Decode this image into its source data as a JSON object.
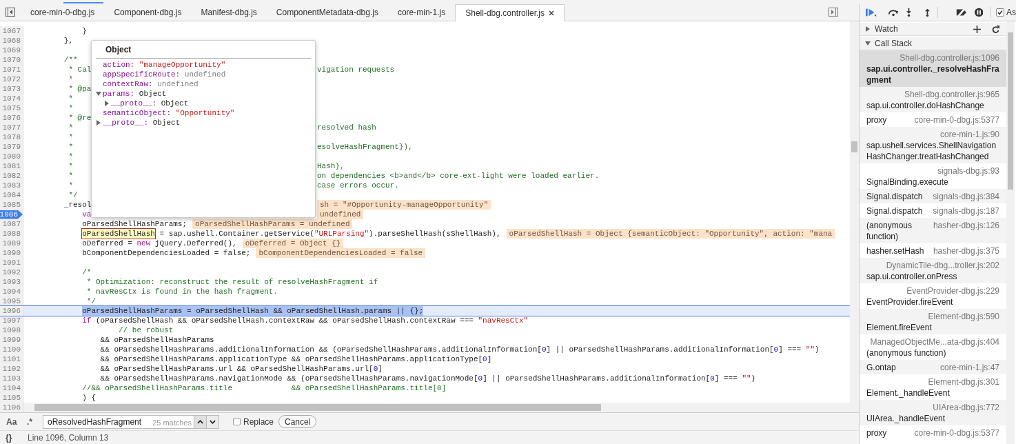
{
  "tabs": [
    {
      "label": "core-min-0-dbg.js",
      "selected": false
    },
    {
      "label": "Component-dbg.js",
      "selected": false
    },
    {
      "label": "Manifest-dbg.js",
      "selected": false
    },
    {
      "label": "ComponentMetadata-dbg.js",
      "selected": false
    },
    {
      "label": "core-min-1.js",
      "selected": false
    },
    {
      "label": "Shell-dbg.controller.js",
      "selected": true
    }
  ],
  "code": {
    "lines": [
      {
        "number": "1067",
        "breakpoint": false,
        "current": false,
        "segments": [
          {
            "kind": "plain",
            "text": "            }"
          }
        ]
      },
      {
        "number": "1068",
        "breakpoint": false,
        "current": false,
        "segments": [
          {
            "kind": "plain",
            "text": "        },"
          }
        ]
      },
      {
        "number": "1069",
        "breakpoint": false,
        "current": false
      },
      {
        "number": "1070",
        "breakpoint": false,
        "current": false,
        "segments": [
          {
            "kind": "comment",
            "text": "        /**"
          }
        ]
      },
      {
        "number": "1071",
        "breakpoint": false,
        "current": false,
        "segments": [
          {
            "kind": "comment",
            "text": "         * Cal"
          }
        ],
        "after_popover": [
          {
            "kind": "comment",
            "text": "vigation requests"
          }
        ]
      },
      {
        "number": "1072",
        "breakpoint": false,
        "current": false,
        "segments": [
          {
            "kind": "comment",
            "text": "         *"
          }
        ]
      },
      {
        "number": "1073",
        "breakpoint": false,
        "current": false,
        "segments": [
          {
            "kind": "comment",
            "text": "         * @pa"
          }
        ]
      },
      {
        "number": "1074",
        "breakpoint": false,
        "current": false,
        "segments": [
          {
            "kind": "comment",
            "text": "         *"
          }
        ]
      },
      {
        "number": "1075",
        "breakpoint": false,
        "current": false,
        "segments": [
          {
            "kind": "comment",
            "text": "         *"
          }
        ]
      },
      {
        "number": "1076",
        "breakpoint": false,
        "current": false,
        "segments": [
          {
            "kind": "comment",
            "text": "         * @re"
          }
        ]
      },
      {
        "number": "1077",
        "breakpoint": false,
        "current": false,
        "segments": [
          {
            "kind": "comment",
            "text": "         *"
          }
        ],
        "after_popover": [
          {
            "kind": "comment",
            "text": "resolved hash"
          }
        ]
      },
      {
        "number": "1078",
        "breakpoint": false,
        "current": false,
        "segments": [
          {
            "kind": "comment",
            "text": "         *"
          }
        ]
      },
      {
        "number": "1079",
        "breakpoint": false,
        "current": false,
        "segments": [
          {
            "kind": "comment",
            "text": "         *"
          }
        ],
        "after_popover": [
          {
            "kind": "comment",
            "text": "esolveHashFragment}),"
          }
        ]
      },
      {
        "number": "1080",
        "breakpoint": false,
        "current": false,
        "segments": [
          {
            "kind": "comment",
            "text": "         *"
          }
        ]
      },
      {
        "number": "1081",
        "breakpoint": false,
        "current": false,
        "segments": [
          {
            "kind": "comment",
            "text": "         *"
          }
        ],
        "after_popover": [
          {
            "kind": "comment",
            "text": "Hash},"
          }
        ]
      },
      {
        "number": "1082",
        "breakpoint": false,
        "current": false,
        "segments": [
          {
            "kind": "comment",
            "text": "         *"
          }
        ],
        "after_popover": [
          {
            "kind": "comment",
            "text": "on dependencies <b>and</b> core-ext-light were loaded earlier."
          }
        ]
      },
      {
        "number": "1083",
        "breakpoint": false,
        "current": false,
        "segments": [
          {
            "kind": "comment",
            "text": "         *"
          }
        ],
        "after_popover": [
          {
            "kind": "comment",
            "text": "case errors occur."
          }
        ]
      },
      {
        "number": "1084",
        "breakpoint": false,
        "current": false,
        "segments": [
          {
            "kind": "comment",
            "text": "         */"
          }
        ]
      },
      {
        "number": "1085",
        "breakpoint": false,
        "current": false,
        "segments": [
          {
            "kind": "plain",
            "text": "        _resol"
          }
        ],
        "after_popover": [
          {
            "kind": "inline_value",
            "text": "sh = \"#Opportunity-manageOpportunity\""
          }
        ]
      },
      {
        "number": "1086",
        "breakpoint": true,
        "current": false,
        "segments": [
          {
            "kind": "keyword",
            "text": "            va"
          }
        ],
        "after_popover": [
          {
            "kind": "inline_value",
            "text": "undefined"
          }
        ]
      },
      {
        "number": "1087",
        "breakpoint": false,
        "current": false,
        "segments": [
          {
            "kind": "plain",
            "text": "            oParsedShellHashParams;"
          },
          {
            "kind": "inline_value",
            "text": "oParsedShellHashParams = undefined"
          }
        ]
      },
      {
        "number": "1088",
        "breakpoint": false,
        "current": false,
        "segments": [
          {
            "kind": "hovered",
            "text": "            oParsedShellHash"
          },
          {
            "kind": "plain",
            "text": " = sap.ushell.Container.getService("
          },
          {
            "kind": "string",
            "text": "\"URLParsing\""
          },
          {
            "kind": "plain",
            "text": ").parseShellHash(sShellHash),"
          },
          {
            "kind": "inline_value",
            "text": "oParsedShellHash = Object {semanticObject: \"Opportunity\", action: \"mana"
          }
        ]
      },
      {
        "number": "1089",
        "breakpoint": false,
        "current": false,
        "segments": [
          {
            "kind": "plain",
            "text": "            oDeferred = "
          },
          {
            "kind": "keyword",
            "text": "new"
          },
          {
            "kind": "plain",
            "text": " jQuery.Deferred(),"
          },
          {
            "kind": "inline_value",
            "text": "oDeferred = Object {}"
          }
        ]
      },
      {
        "number": "1090",
        "breakpoint": false,
        "current": false,
        "segments": [
          {
            "kind": "plain",
            "text": "            bComponentDependenciesLoaded = false;"
          },
          {
            "kind": "inline_value",
            "text": "bComponentDependenciesLoaded = false"
          }
        ]
      },
      {
        "number": "1091",
        "breakpoint": false,
        "current": false
      },
      {
        "number": "1092",
        "breakpoint": false,
        "current": false,
        "segments": [
          {
            "kind": "comment",
            "text": "            /*"
          }
        ]
      },
      {
        "number": "1093",
        "breakpoint": false,
        "current": false,
        "segments": [
          {
            "kind": "comment",
            "text": "             * Optimization: reconstruct the result of resolveHashFragment if"
          }
        ]
      },
      {
        "number": "1094",
        "breakpoint": false,
        "current": false,
        "segments": [
          {
            "kind": "comment",
            "text": "             * navResCtx is found in the hash fragment."
          }
        ]
      },
      {
        "number": "1095",
        "breakpoint": false,
        "current": false,
        "segments": [
          {
            "kind": "comment",
            "text": "             */"
          }
        ]
      },
      {
        "number": "1096",
        "breakpoint": false,
        "current": true,
        "segments": [
          {
            "kind": "match",
            "text": "            oParsedShellHashParams = oParsedShellHash && oParsedShellHash.params || {};"
          }
        ]
      },
      {
        "number": "1097",
        "breakpoint": false,
        "current": false,
        "segments": [
          {
            "kind": "keyword",
            "text": "            if"
          },
          {
            "kind": "plain",
            "text": " (oParsedShellHash && oParsedShellHash.contextRaw && oParsedShellHash.contextRaw === "
          },
          {
            "kind": "string",
            "text": "\"navResCtx\""
          }
        ]
      },
      {
        "number": "1098",
        "breakpoint": false,
        "current": false,
        "segments": [
          {
            "kind": "comment",
            "text": "                    // be robust"
          }
        ]
      },
      {
        "number": "1099",
        "breakpoint": false,
        "current": false,
        "segments": [
          {
            "kind": "plain",
            "text": "                && oParsedShellHashParams"
          }
        ]
      },
      {
        "number": "1100",
        "breakpoint": false,
        "current": false,
        "segments": [
          {
            "kind": "plain",
            "text": "                && oParsedShellHashParams.additionalInformation && (oParsedShellHashParams.additionalInformation["
          },
          {
            "kind": "number",
            "text": "0"
          },
          {
            "kind": "plain",
            "text": "] || oParsedShellHashParams.additionalInformation["
          },
          {
            "kind": "number",
            "text": "0"
          },
          {
            "kind": "plain",
            "text": "] === "
          },
          {
            "kind": "string",
            "text": "\"\""
          },
          {
            "kind": "plain",
            "text": ")"
          }
        ]
      },
      {
        "number": "1101",
        "breakpoint": false,
        "current": false,
        "segments": [
          {
            "kind": "plain",
            "text": "                && oParsedShellHashParams.applicationType && oParsedShellHashParams.applicationType["
          },
          {
            "kind": "number",
            "text": "0"
          },
          {
            "kind": "plain",
            "text": "]"
          }
        ]
      },
      {
        "number": "1102",
        "breakpoint": false,
        "current": false,
        "segments": [
          {
            "kind": "plain",
            "text": "                && oParsedShellHashParams.url && oParsedShellHashParams.url["
          },
          {
            "kind": "number",
            "text": "0"
          },
          {
            "kind": "plain",
            "text": "]"
          }
        ]
      },
      {
        "number": "1103",
        "breakpoint": false,
        "current": false,
        "segments": [
          {
            "kind": "plain",
            "text": "                && oParsedShellHashParams.navigationMode && (oParsedShellHashParams.navigationMode["
          },
          {
            "kind": "number",
            "text": "0"
          },
          {
            "kind": "plain",
            "text": "] || oParsedShellHashParams.additionalInformation["
          },
          {
            "kind": "number",
            "text": "0"
          },
          {
            "kind": "plain",
            "text": "] === "
          },
          {
            "kind": "string",
            "text": "\"\""
          },
          {
            "kind": "plain",
            "text": ")"
          }
        ]
      },
      {
        "number": "1104",
        "breakpoint": false,
        "current": false,
        "segments": [
          {
            "kind": "comment",
            "text": "            //&& oParsedShellHashParams.title             && oParsedShellHashParams.title[0]"
          }
        ]
      },
      {
        "number": "1105",
        "breakpoint": false,
        "current": false,
        "segments": [
          {
            "kind": "plain",
            "text": "            ) {"
          }
        ]
      },
      {
        "number": "1106",
        "breakpoint": false,
        "current": false
      }
    ]
  },
  "popover": {
    "title": "Object",
    "properties": [
      {
        "key": "action:",
        "value": "\"manageOpportunity\"",
        "kind": "string"
      },
      {
        "key": "appSpecificRoute:",
        "value": "undefined",
        "kind": "undefined"
      },
      {
        "key": "contextRaw:",
        "value": "undefined",
        "kind": "undefined"
      },
      {
        "key": "params:",
        "value": "Object",
        "kind": "object",
        "expanded": true,
        "children": [
          {
            "key": "__proto__:",
            "value": "Object",
            "kind": "object",
            "expanded": false
          }
        ]
      },
      {
        "key": "semanticObject:",
        "value": "\"Opportunity\"",
        "kind": "string"
      },
      {
        "key": "__proto__:",
        "value": "Object",
        "kind": "object",
        "expanded": false
      }
    ]
  },
  "search_bar": {
    "case_toggle": "Aa",
    "regex_toggle": ".*",
    "value": "oResolvedHashFragment",
    "matches": "25 matches",
    "replace": {
      "label": "Replace",
      "checked": false
    },
    "cancel": "Cancel"
  },
  "status_bar": {
    "format_button": "{}",
    "cursor": "Line 1096, Column 13"
  },
  "debugger": {
    "async": {
      "label": "As",
      "checked": true
    },
    "sections": [
      {
        "title": "Watch",
        "expanded": false
      },
      {
        "title": "Call Stack",
        "expanded": true
      }
    ],
    "frames": [
      {
        "function": "sap.ui.controller._resolveHashFragment",
        "location": "Shell-dbg.controller.js:1096",
        "kind": "stacked",
        "selected": true
      },
      {
        "function": "sap.ui.controller.doHashChange",
        "location": "Shell-dbg.controller.js:965",
        "kind": "stacked",
        "selected": false
      },
      {
        "function": "proxy",
        "location": "core-min-0-dbg.js:5377",
        "kind": "inline",
        "selected": false
      },
      {
        "function": "sap.ushell.services.ShellNavigationHashChanger.treatHashChanged",
        "location": "core-min-1.js:90",
        "kind": "stacked",
        "selected": false
      },
      {
        "function": "SignalBinding.execute",
        "location": "signals-dbg.js:93",
        "kind": "stacked",
        "selected": false
      },
      {
        "function": "Signal.dispatch",
        "location": "signals-dbg.js:384",
        "kind": "inline",
        "selected": false
      },
      {
        "function": "Signal.dispatch",
        "location": "signals-dbg.js:187",
        "kind": "inline",
        "selected": false
      },
      {
        "function": "(anonymous function)",
        "location": "hasher-dbg.js:126",
        "kind": "inline",
        "selected": false
      },
      {
        "function": "hasher.setHash",
        "location": "hasher-dbg.js:375",
        "kind": "inline",
        "selected": false
      },
      {
        "function": "sap.ui.controller.onPress",
        "location": "DynamicTile-dbg...troller.js:202",
        "kind": "stacked",
        "selected": false
      },
      {
        "function": "EventProvider.fireEvent",
        "location": "EventProvider-dbg.js:229",
        "kind": "stacked",
        "selected": false
      },
      {
        "function": "Element.fireEvent",
        "location": "Element-dbg.js:590",
        "kind": "stacked",
        "selected": false
      },
      {
        "function": "(anonymous function)",
        "location": "ManagedObjectMe...ata-dbg.js:404",
        "kind": "stacked",
        "selected": false
      },
      {
        "function": "G.ontap",
        "location": "core-min-1.js:47",
        "kind": "inline",
        "selected": false
      },
      {
        "function": "Element._handleEvent",
        "location": "Element-dbg.js:301",
        "kind": "stacked",
        "selected": false
      },
      {
        "function": "UIArea._handleEvent",
        "location": "UIArea-dbg.js:772",
        "kind": "stacked",
        "selected": false
      },
      {
        "function": "proxy",
        "location": "core-min-0-dbg.js:5377",
        "kind": "inline",
        "selected": false
      }
    ]
  }
}
